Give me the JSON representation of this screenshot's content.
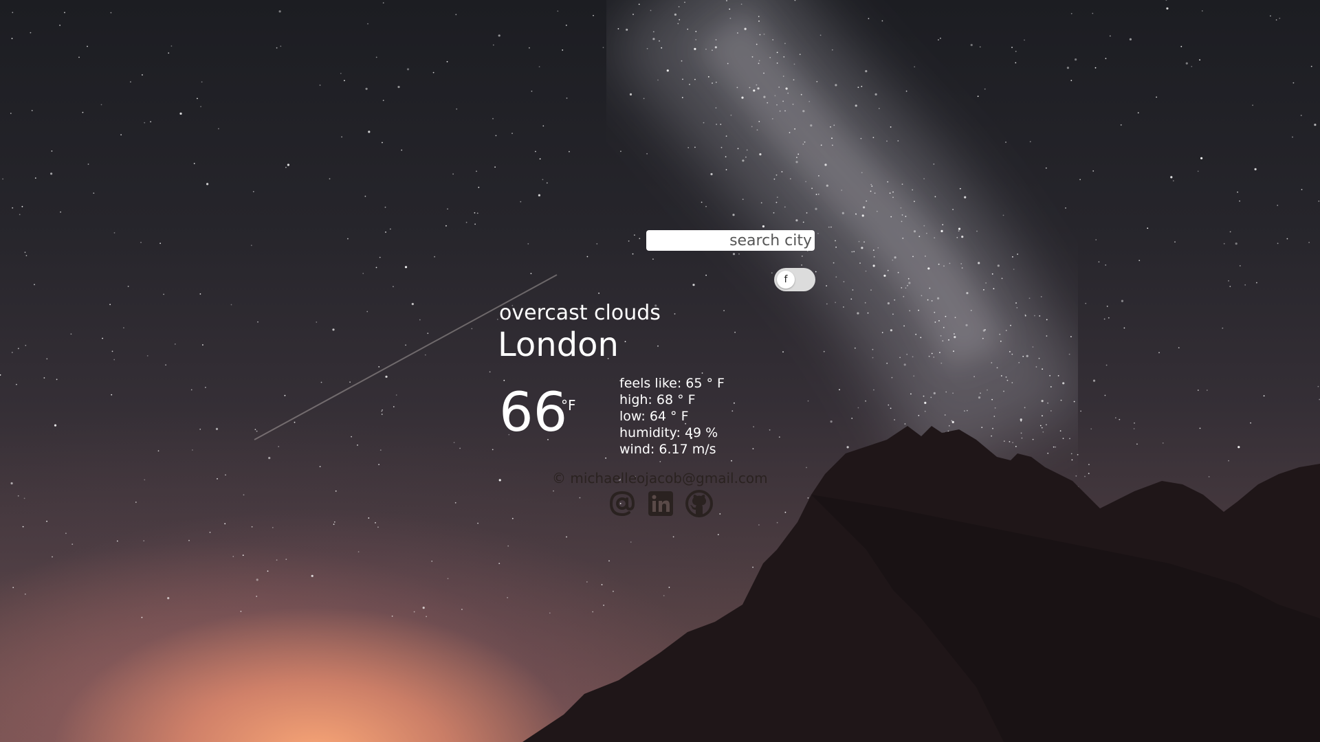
{
  "search": {
    "placeholder": "search city",
    "value": ""
  },
  "unit_toggle": {
    "label": "f",
    "state": "off"
  },
  "weather": {
    "description": "overcast clouds",
    "city": "London",
    "temperature": "66",
    "temperature_unit": "°F",
    "feels_like": "feels like: 65 ° F",
    "high": "high: 68 ° F",
    "low": "low: 64 ° F",
    "humidity": "humidity: 49 %",
    "wind": "wind: 6.17 m/s"
  },
  "footer": {
    "copyright": "© michaelleojacob@gmail.com",
    "links": [
      {
        "icon": "at-sign-icon"
      },
      {
        "icon": "linkedin-icon"
      },
      {
        "icon": "github-icon"
      }
    ]
  },
  "colors": {
    "text": "#ffffff",
    "footer_text": "#2a2220",
    "input_bg": "#ffffff",
    "toggle_bg": "#dcdcdc"
  }
}
